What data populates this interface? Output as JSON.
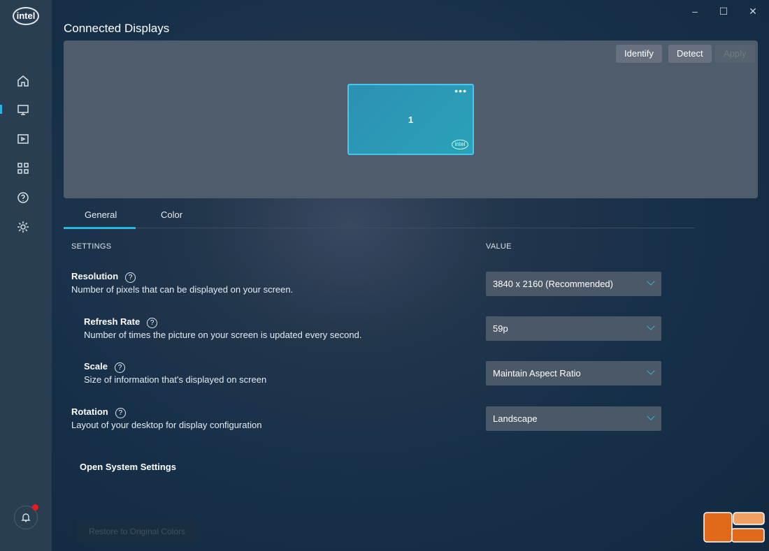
{
  "app": {
    "logo": "intel",
    "title": "Connected Displays"
  },
  "window": {
    "minimize": "–",
    "maximize": "☐",
    "close": "✕"
  },
  "sidebar": {
    "items": [
      {
        "icon": "home-icon"
      },
      {
        "icon": "display-icon",
        "active": true
      },
      {
        "icon": "video-icon"
      },
      {
        "icon": "apps-icon"
      },
      {
        "icon": "help-icon"
      },
      {
        "icon": "gear-icon"
      }
    ],
    "notification": {
      "icon": "bell-icon",
      "has_alert": true
    }
  },
  "display_panel": {
    "buttons": {
      "identify": "Identify",
      "detect": "Detect",
      "apply": "Apply"
    },
    "monitor": {
      "number": "1",
      "menu": "•••",
      "brand": "intel"
    }
  },
  "tabs": [
    {
      "label": "General",
      "active": true
    },
    {
      "label": "Color"
    }
  ],
  "headers": {
    "settings": "SETTINGS",
    "value": "VALUE"
  },
  "settings": [
    {
      "name": "Resolution",
      "help": "?",
      "desc": "Number of pixels that can be displayed on your screen.",
      "value": "3840 x 2160 (Recommended)"
    },
    {
      "name": "Refresh Rate",
      "help": "?",
      "desc": "Number of times the picture on your screen is updated every second.",
      "value": "59p"
    },
    {
      "name": "Scale",
      "help": "?",
      "desc": "Size of information that's displayed on screen",
      "value": "Maintain Aspect Ratio"
    },
    {
      "name": "Rotation",
      "help": "?",
      "desc": "Layout of your desktop for display configuration",
      "value": "Landscape"
    }
  ],
  "open_system_settings": "Open System Settings",
  "restore": "Restore to Original Colors",
  "colors": {
    "accent": "#27b3e5",
    "alert": "#e61d1d"
  }
}
